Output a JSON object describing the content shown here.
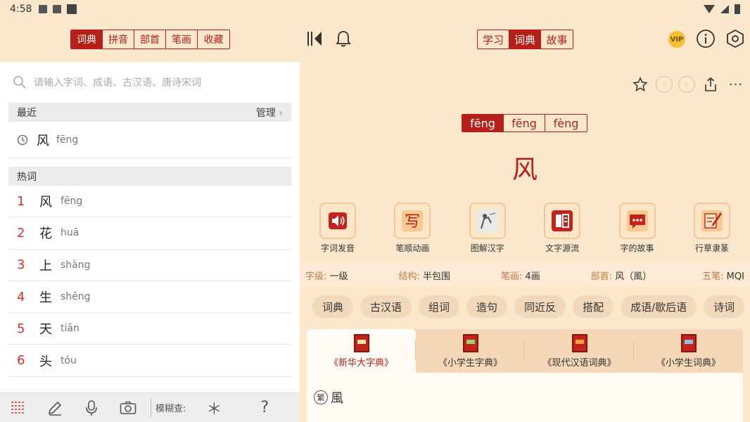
{
  "status": {
    "time": "4:58"
  },
  "topbar": {
    "left_tabs": [
      {
        "label": "词典",
        "active": true
      },
      {
        "label": "拼音",
        "active": false
      },
      {
        "label": "部首",
        "active": false
      },
      {
        "label": "笔画",
        "active": false
      },
      {
        "label": "收藏",
        "active": false
      }
    ],
    "mid_tabs": [
      {
        "label": "学习",
        "active": false
      },
      {
        "label": "词典",
        "active": true
      },
      {
        "label": "故事",
        "active": false
      }
    ],
    "vip_label": "VIP",
    "accent": "#b5201b"
  },
  "search": {
    "placeholder": "请输入字词、成语、古汉语、唐诗宋词"
  },
  "recent": {
    "title": "最近",
    "manage": "管理",
    "items": [
      {
        "char": "风",
        "pinyin": "fēng"
      }
    ]
  },
  "hot": {
    "title": "热词",
    "items": [
      {
        "num": "1",
        "char": "风",
        "pinyin": "fēng"
      },
      {
        "num": "2",
        "char": "花",
        "pinyin": "huā"
      },
      {
        "num": "3",
        "char": "上",
        "pinyin": "shàng"
      },
      {
        "num": "4",
        "char": "生",
        "pinyin": "shēng"
      },
      {
        "num": "5",
        "char": "天",
        "pinyin": "tiān"
      },
      {
        "num": "6",
        "char": "头",
        "pinyin": "tóu"
      }
    ]
  },
  "bottombar": {
    "fuzzy_label": "模糊查:",
    "star": "＊",
    "question": "?"
  },
  "entry": {
    "pinyins": [
      {
        "label": "fēng",
        "active": true
      },
      {
        "label": "fēng",
        "active": false
      },
      {
        "label": "fèng",
        "active": false
      }
    ],
    "char": "风",
    "features": [
      {
        "label": "字词发音",
        "icon": "speaker-icon"
      },
      {
        "label": "笔顺动画",
        "icon": "write-icon"
      },
      {
        "label": "图解汉字",
        "icon": "picture-icon"
      },
      {
        "label": "文字源流",
        "icon": "book-origin-icon"
      },
      {
        "label": "字的故事",
        "icon": "story-icon"
      },
      {
        "label": "行草隶篆",
        "icon": "brush-icon"
      }
    ],
    "props": {
      "level_k": "字级:",
      "level_v": "一级",
      "struct_k": "结构:",
      "struct_v": "半包围",
      "strokes_k": "笔画:",
      "strokes_v": "4画",
      "radical_k": "部首:",
      "radical_v": "风（風）",
      "wubi_k": "五笔:",
      "wubi_v": "MQI"
    },
    "tabs": [
      "词典",
      "古汉语",
      "组词",
      "造句",
      "同近反",
      "搭配",
      "成语/歇后语",
      "诗词"
    ],
    "books": [
      {
        "label": "《新华大字典》",
        "active": true
      },
      {
        "label": "《小学生字典》",
        "active": false
      },
      {
        "label": "《现代汉语词典》",
        "active": false
      },
      {
        "label": "《小学生词典》",
        "active": false
      }
    ],
    "trad_badge": "繁",
    "trad_char": "風"
  }
}
